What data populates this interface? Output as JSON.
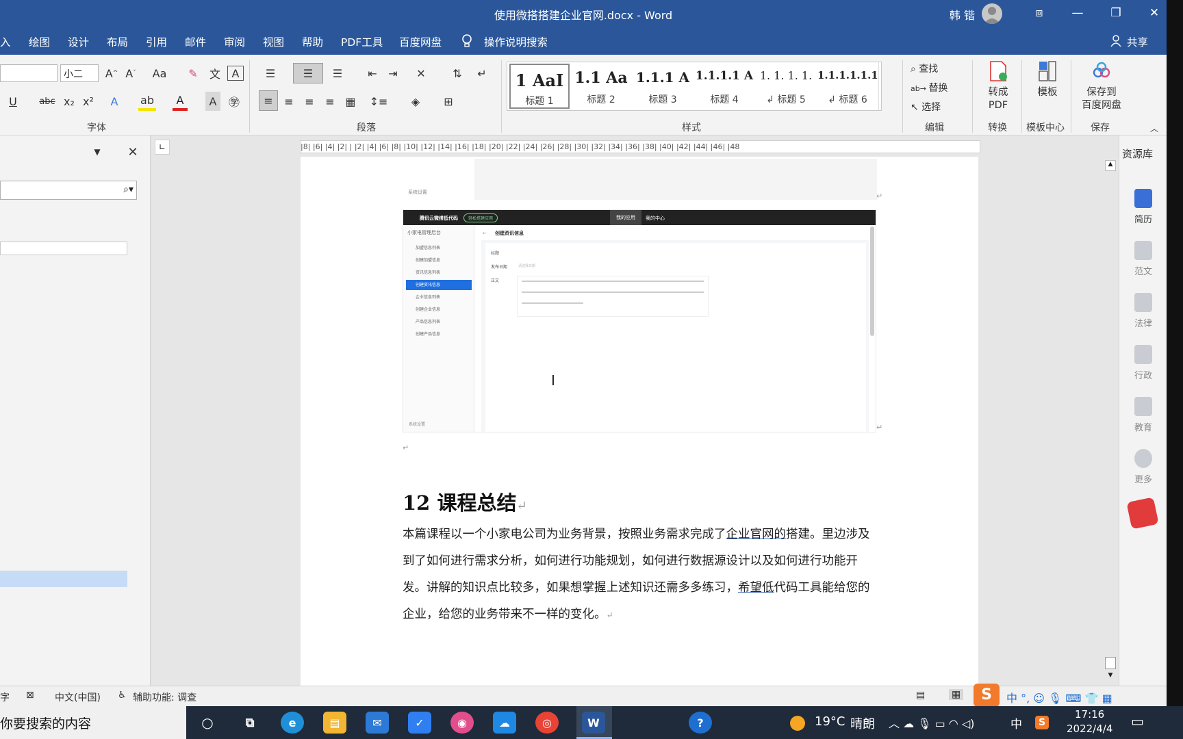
{
  "window": {
    "title": "使用微搭搭建企业官网.docx  -  Word",
    "user": "韩 锴",
    "controls": {
      "restore_ribbon": "⧈",
      "minimize": "—",
      "maximize": "❐",
      "close": "✕"
    }
  },
  "menu": {
    "items": [
      "入",
      "绘图",
      "设计",
      "布局",
      "引用",
      "邮件",
      "审阅",
      "视图",
      "帮助",
      "PDF工具",
      "百度网盘"
    ],
    "tell_me": "操作说明搜索",
    "share": "共享"
  },
  "ribbon": {
    "font_size": "小二",
    "font_group": "字体",
    "paragraph_group": "段落",
    "styles_group": "样式",
    "edit_group": "编辑",
    "convert_group": "转换",
    "template_group": "模板中心",
    "save_group": "保存",
    "styles": [
      {
        "sample": "1  AaI",
        "label": "标题 1"
      },
      {
        "sample": "1.1  Aa",
        "label": "标题 2"
      },
      {
        "sample": "1.1.1  A",
        "label": "标题 3"
      },
      {
        "sample": "1.1.1.1  A",
        "label": "标题 4"
      },
      {
        "sample": "1. 1. 1. 1.",
        "label": "↲ 标题 5"
      },
      {
        "sample": "1.1.1.1.1.1",
        "label": "↲ 标题 6"
      }
    ],
    "edit": {
      "find": "查找",
      "replace": "替换",
      "select": "选择"
    },
    "convert_pdf": "转成\nPDF",
    "template": "模板",
    "save_baidu": "保存到\n百度网盘"
  },
  "ruler_text": "|8|  |6|  |4|  |2|  |  |2|  |4|  |6|  |8|  |10|  |12|  |14|  |16|  |18|  |20|  |22|  |24|  |26|  |28|  |30|  |32|  |34|  |36|  |38|  |40|  |42|  |44|  |46|  |48",
  "document": {
    "embedded": {
      "top_label": "系统设置",
      "brand": "腾讯云微搭低代码",
      "brand_badge": "轻松搭建应用",
      "top_tabs": [
        "我的应用",
        "我的中心"
      ],
      "app_selector": "小家电管理后台",
      "page_title": "创建资讯信息",
      "side_items": [
        "加盟信息列表",
        "创建加盟信息",
        "资讯信息列表",
        "创建资讯信息",
        "企业信息列表",
        "创建企业信息",
        "产品信息列表",
        "创建产品信息"
      ],
      "active_index": 3,
      "form_labels": [
        "标题",
        "发布日期",
        "正文"
      ],
      "date_placeholder": "请选择日期",
      "bottom_label": "系统设置"
    },
    "heading": "12 课程总结",
    "paragraph": {
      "p1": "本篇课程以一个小家电公司为业务背景，按照业务需求完成了",
      "u1": "企业官网的",
      "p2": "搭建。里边涉及到了如何进行需求分析，如何进行功能规划，如何进行数据源设计以及如何进行功能开发。讲解的知识点比较多，如果想掌握上述知识还需多多练习，",
      "u2": "希望低",
      "p3": "代码工具能给您的企业，给您的业务带来不一样的变化。"
    }
  },
  "right_pane": {
    "title": "资源库",
    "items": [
      "简历",
      "范文",
      "法律",
      "行政",
      "教育",
      "更多"
    ]
  },
  "status_bar": {
    "word_count": "字",
    "language": "中文(中国)",
    "accessibility": "辅助功能: 调查"
  },
  "taskbar": {
    "search_placeholder": "你要搜索的内容",
    "weather_temp": "19°C",
    "weather_desc": "晴朗",
    "ime": "中",
    "time": "17:16",
    "date": "2022/4/4",
    "app_word_label": "W"
  },
  "colors": {
    "word_blue": "#2b579a",
    "ribbon_bg": "#f3f3f3",
    "accent_blue": "#1f6fe0"
  }
}
